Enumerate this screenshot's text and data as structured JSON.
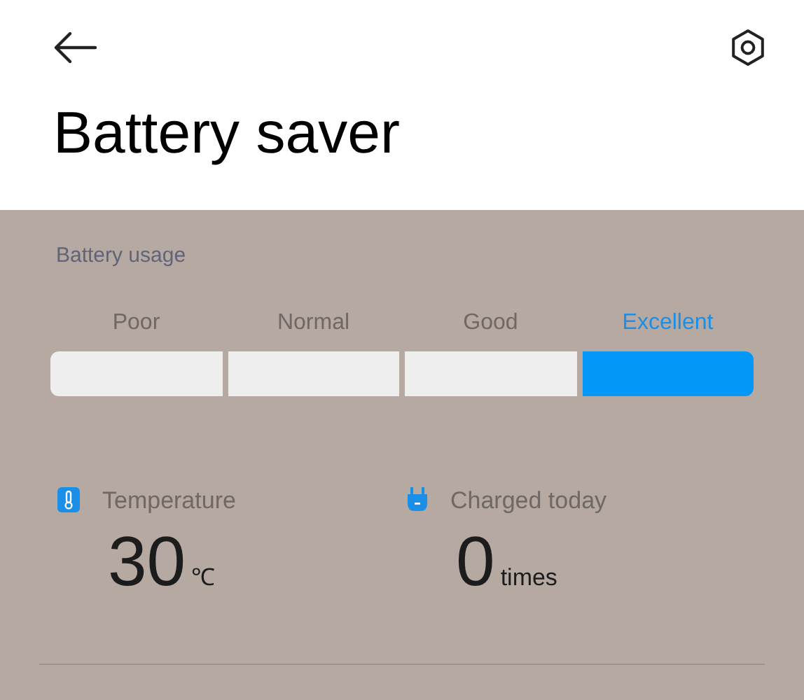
{
  "header": {
    "title": "Battery saver"
  },
  "battery_usage": {
    "heading": "Battery usage",
    "levels": [
      {
        "label": "Poor",
        "selected": false
      },
      {
        "label": "Normal",
        "selected": false
      },
      {
        "label": "Good",
        "selected": false
      },
      {
        "label": "Excellent",
        "selected": true
      }
    ]
  },
  "stats": [
    {
      "kind": "temperature",
      "label": "Temperature",
      "value": "30",
      "unit": "℃"
    },
    {
      "kind": "charge",
      "label": "Charged today",
      "value": "0",
      "unit": "times"
    }
  ]
}
